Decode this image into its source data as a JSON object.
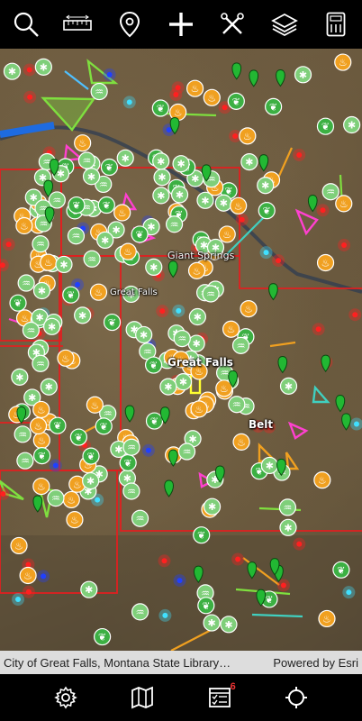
{
  "toolbar": {
    "icons": [
      "search-icon",
      "ruler-icon",
      "map-pin-icon",
      "add-icon",
      "tools-icon",
      "layers-icon",
      "calculator-icon"
    ]
  },
  "map": {
    "labels": {
      "giant_springs": "Giant Springs",
      "great_falls_small": "Great Falls",
      "great_falls_main": "Great Falls",
      "belt": "Belt"
    }
  },
  "attribution": {
    "sources": "City of Great Falls, Montana State Library…",
    "powered_by": "Powered by Esri"
  },
  "bottombar": {
    "icons": [
      "settings-icon",
      "map-icon",
      "checklist-icon",
      "locate-icon"
    ],
    "checklist_badge": "6"
  },
  "colors": {
    "background": "#000000",
    "icon": "#ffffff",
    "boundary": "#e02020",
    "marker_green": "#3cb043",
    "marker_orange": "#f0a020",
    "marker_light_green": "#7fcf7a",
    "badge": "#ee3333"
  }
}
